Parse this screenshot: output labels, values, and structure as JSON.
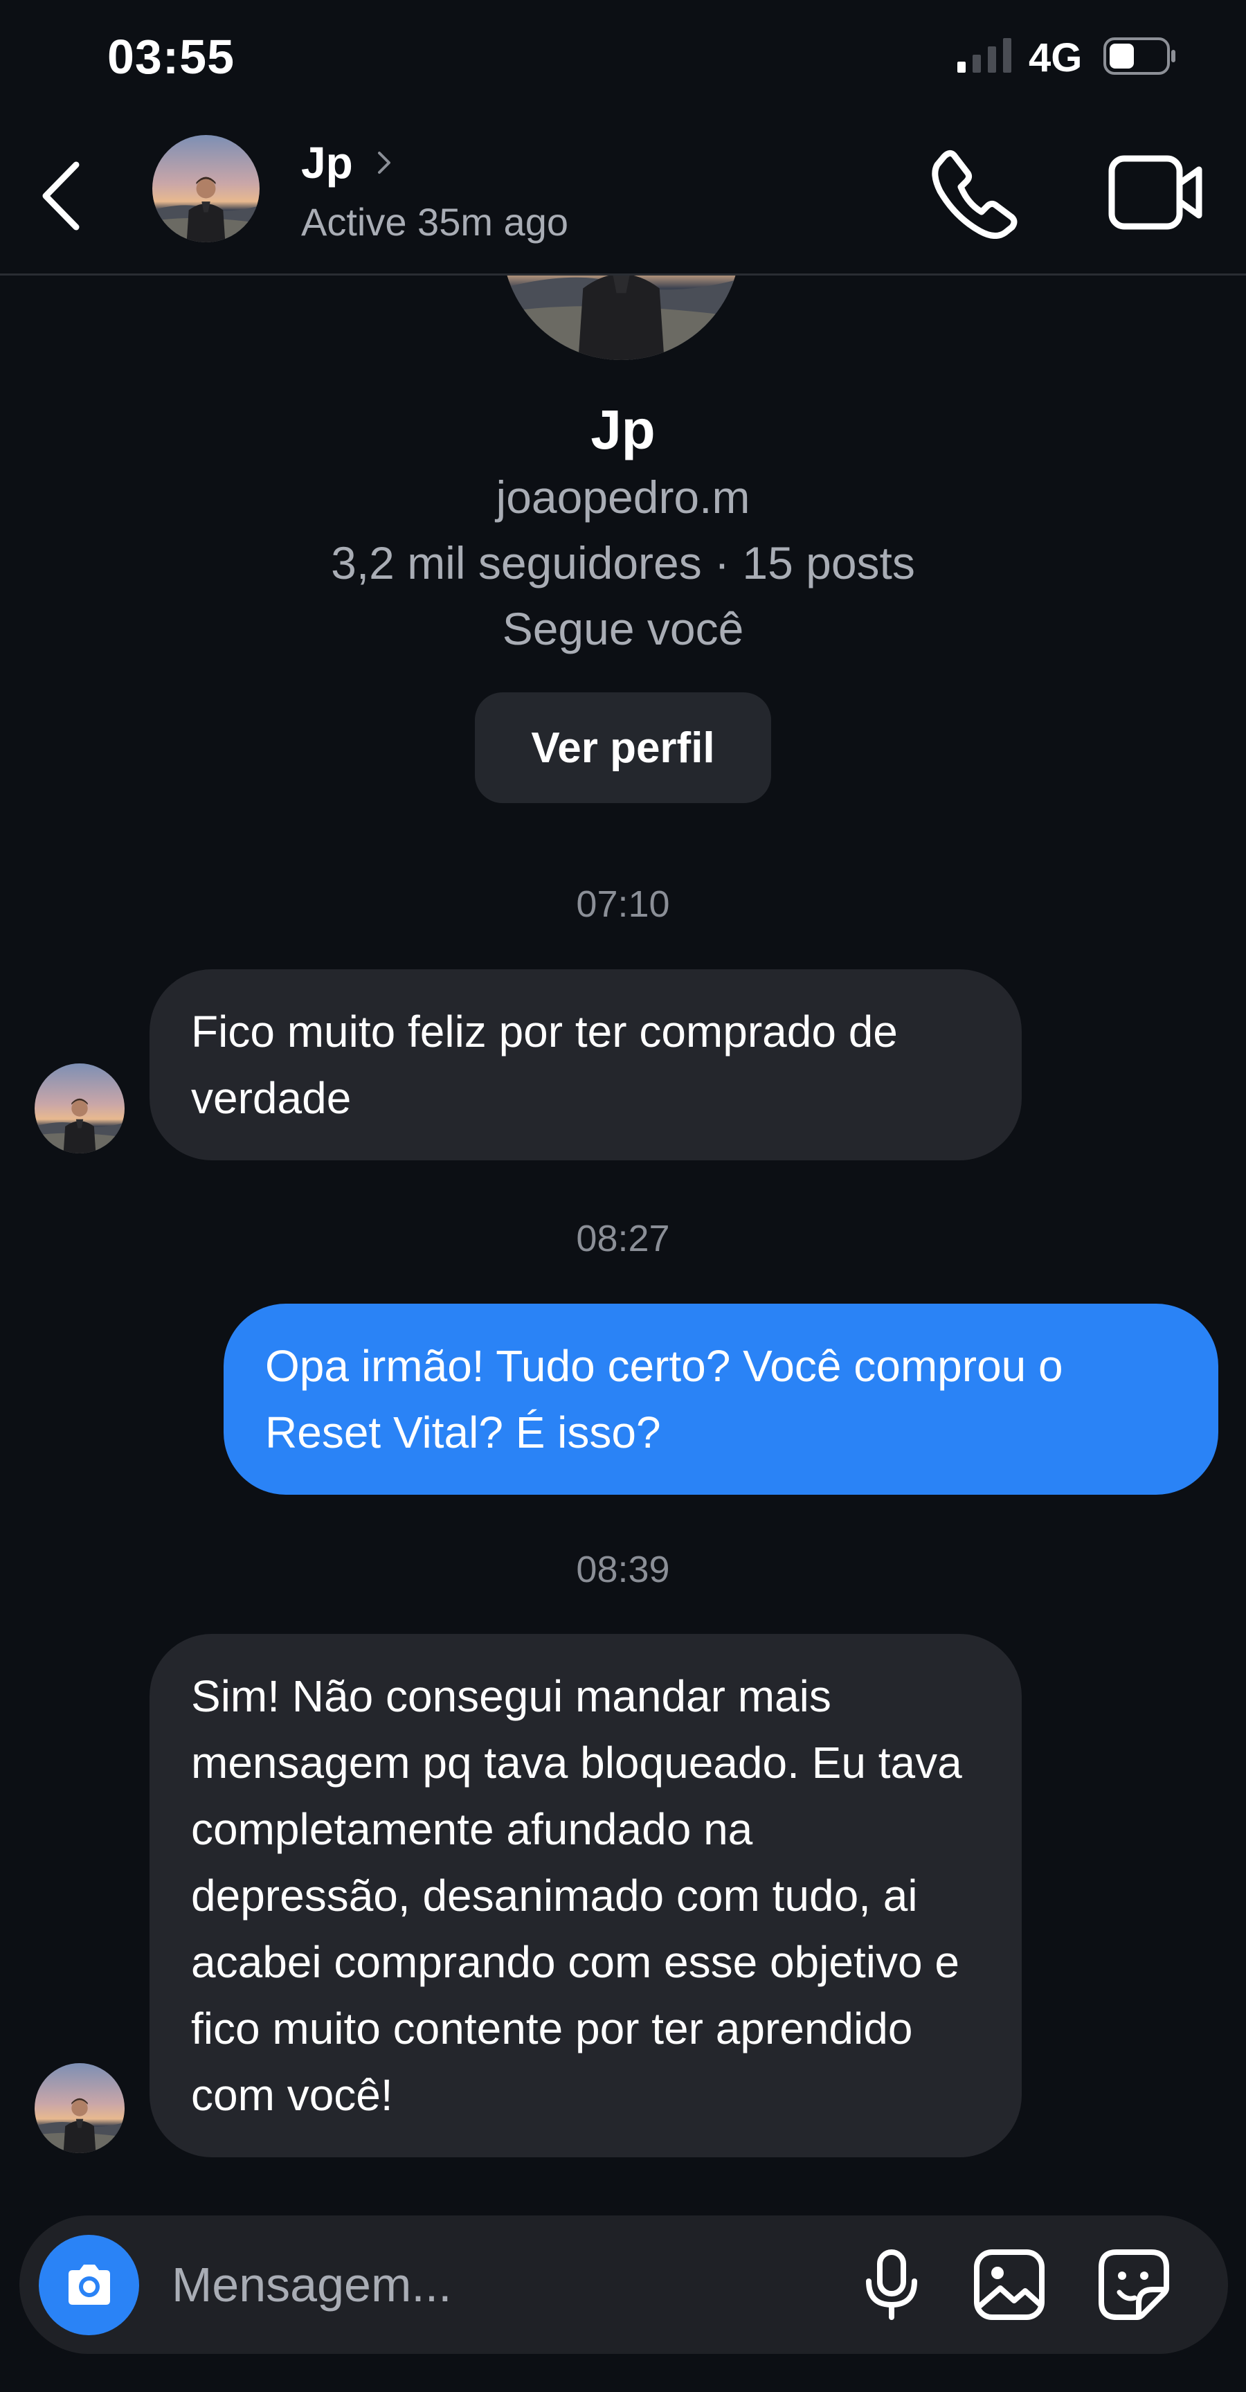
{
  "status_bar": {
    "time": "03:55",
    "network": "4G",
    "battery_level": 0.45,
    "signal_bars": 1
  },
  "header": {
    "name": "Jp",
    "status": "Active 35m ago"
  },
  "profile": {
    "name": "Jp",
    "handle": "joaopedro.m",
    "stats": "3,2 mil seguidores · 15 posts",
    "follow_status": "Segue você",
    "view_profile_label": "Ver perfil"
  },
  "conversation": {
    "timestamps": [
      "07:10",
      "08:27",
      "08:39"
    ],
    "messages": [
      {
        "direction": "incoming",
        "text": "Fico muito feliz por ter comprado de verdade"
      },
      {
        "direction": "outgoing",
        "text": "Opa irmão! Tudo certo? Você comprou o Reset Vital? É isso?"
      },
      {
        "direction": "incoming",
        "text": "Sim! Não consegui mandar mais mensagem pq tava bloqueado. Eu tava completamente afundado na depressão, desanimado com tudo, ai acabei comprando com esse objetivo e fico muito contente por ter aprendido com você!"
      }
    ]
  },
  "composer": {
    "placeholder": "Mensagem..."
  },
  "colors": {
    "background": "#0c0f14",
    "incoming_bubble": "#24262c",
    "outgoing_bubble": "#2a83f6",
    "secondary_text": "#a9adb5"
  }
}
